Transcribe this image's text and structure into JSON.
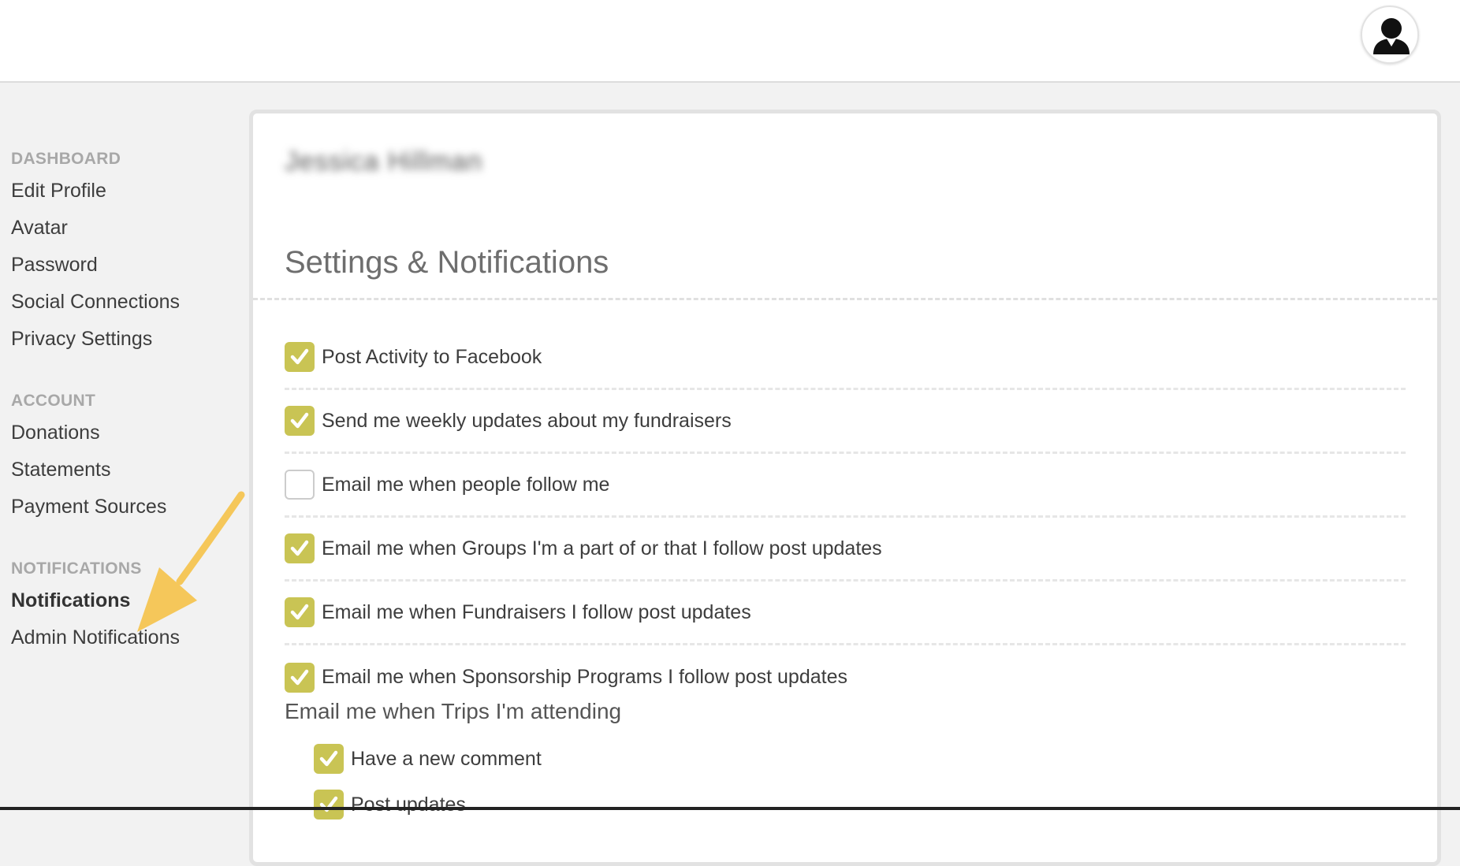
{
  "header": {
    "avatar_icon": "user-silhouette-icon"
  },
  "sidebar": {
    "sections": [
      {
        "heading": "DASHBOARD",
        "items": [
          "Edit Profile",
          "Avatar",
          "Password",
          "Social Connections",
          "Privacy Settings"
        ]
      },
      {
        "heading": "ACCOUNT",
        "items": [
          "Donations",
          "Statements",
          "Payment Sources"
        ]
      },
      {
        "heading": "NOTIFICATIONS",
        "items": [
          "Notifications",
          "Admin Notifications"
        ]
      }
    ],
    "active_item": "Notifications"
  },
  "main": {
    "user_name": "Jessica Hillman",
    "title": "Settings & Notifications",
    "options": [
      {
        "label": "Post Activity to Facebook",
        "checked": true
      },
      {
        "label": "Send me weekly updates about my fundraisers",
        "checked": true
      },
      {
        "label": "Email me when people follow me",
        "checked": false
      },
      {
        "label": "Email me when Groups I'm a part of or that I follow post updates",
        "checked": true
      },
      {
        "label": "Email me when Fundraisers I follow post updates",
        "checked": true
      },
      {
        "label": "Email me when Sponsorship Programs I follow post updates",
        "checked": true
      }
    ],
    "trips_heading": "Email me when Trips I'm attending",
    "trips_options": [
      {
        "label": "Have a new comment",
        "checked": true
      },
      {
        "label": "Post updates",
        "checked": true
      }
    ]
  },
  "colors": {
    "checkbox_checked": "#c9c454",
    "arrow": "#f5c75a",
    "panel_border": "#e2e2e2"
  }
}
